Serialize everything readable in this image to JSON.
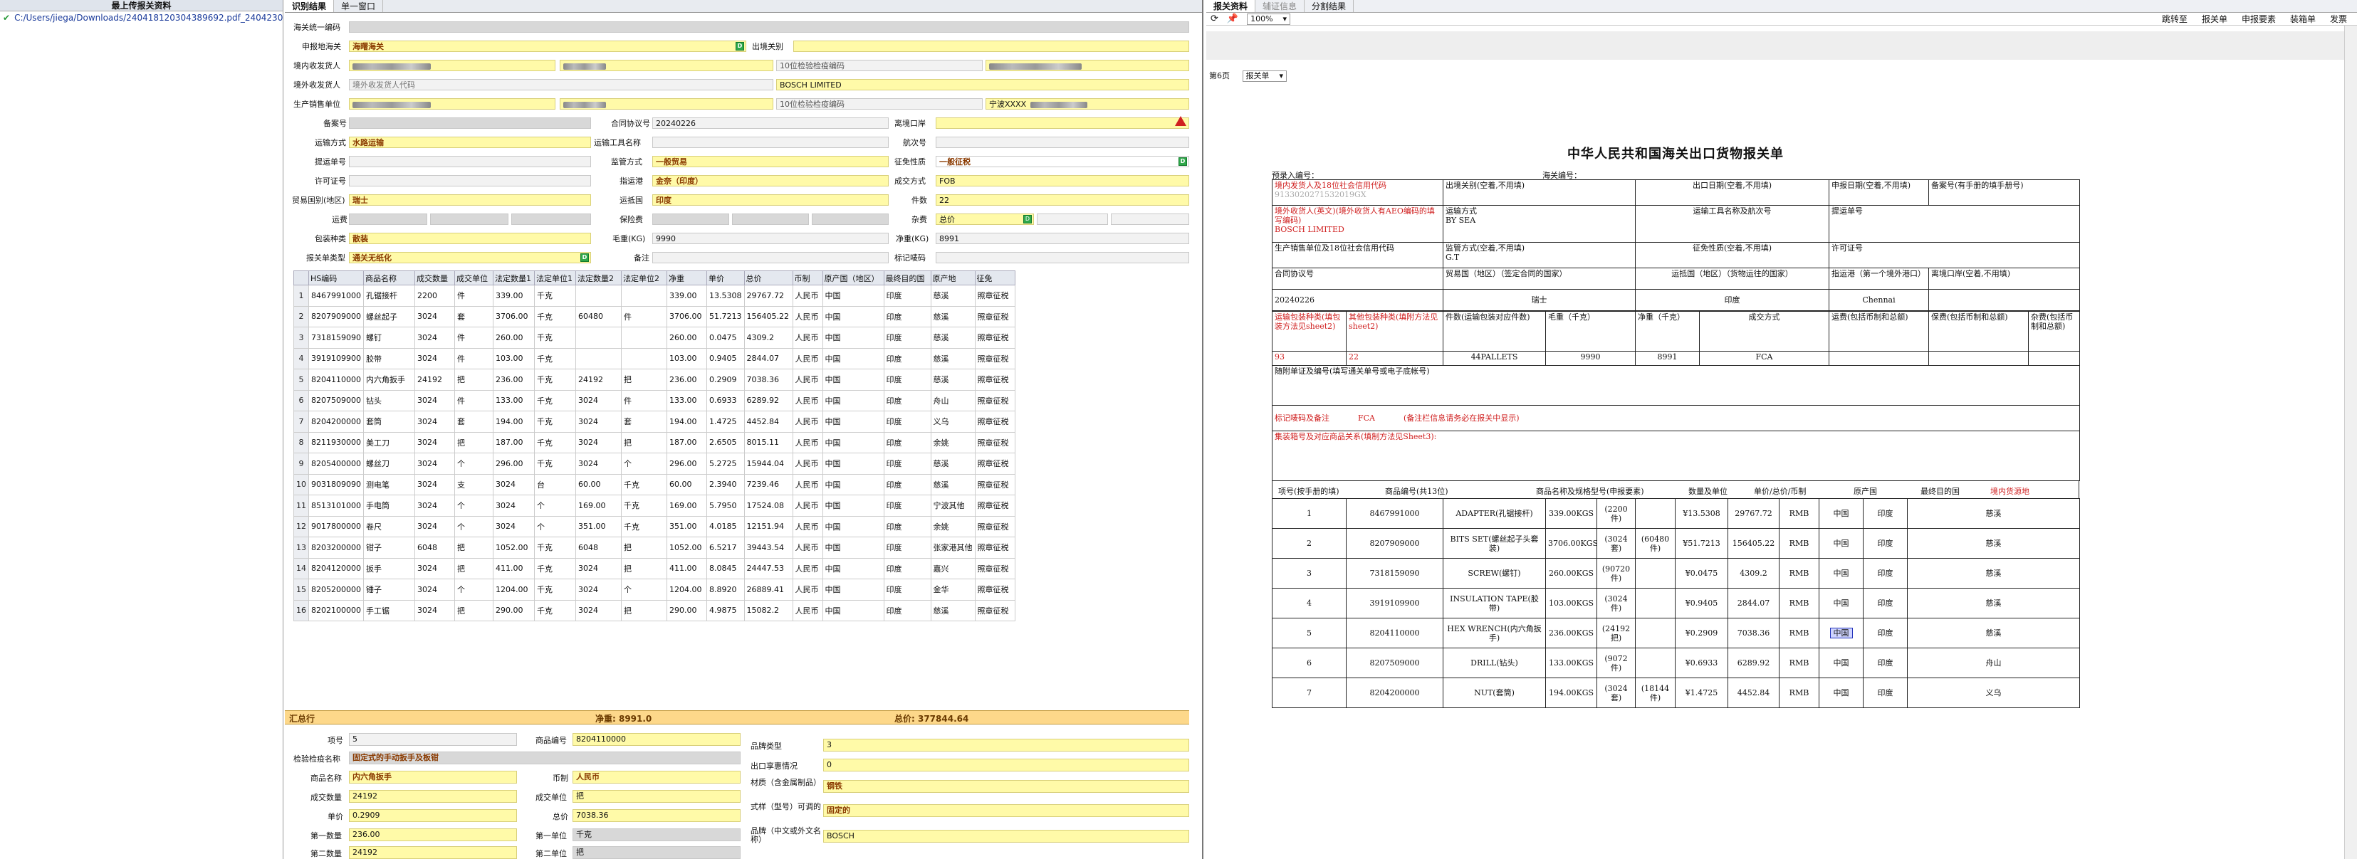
{
  "left_panel": {
    "title": "最上传报关资料",
    "file": "C:/Users/jiega/Downloads/240418120304389692.pdf_240423070"
  },
  "mid_tabs": [
    "识别结果",
    "单一窗口"
  ],
  "form": {
    "pre_entry_no_label": "海关统一编码",
    "declare_customs_label": "申报地海关",
    "declare_customs": "海曙海关",
    "exit_customs_label": "出境关别",
    "domestic_consignor_label": "境内收发货人",
    "domestic_consignor_code": "9133020271532019GX",
    "domestic_consignor_2": "3302...",
    "inspect_code_label": "10位检验检疫编码",
    "overseas_consignee_label": "境外收发货人",
    "overseas_consignee_ph": "境外收发货人代码",
    "overseas_consignee": "BOSCH LIMITED",
    "overseas_inspect_label": "10位检验检疫编码",
    "producer_label": "生产销售单位",
    "producer_company": "宁波XXXX",
    "record_no_label": "备案号",
    "contract_no_label": "合同协议号",
    "contract_no": "20240226",
    "entry_port_label": "离境口岸",
    "transport_label": "运输方式",
    "transport": "水路运输",
    "vehicle_label": "运输工具名称",
    "voyage_label": "航次号",
    "bill_label": "提运单号",
    "supervision_label": "监管方式",
    "supervision": "一般贸易",
    "levy_label": "征免性质",
    "levy": "一般征税",
    "license_label": "许可证号",
    "dest_port_label": "指运港",
    "dest_port": "金奈（印度）",
    "deal_mode_label": "成交方式",
    "deal_mode": "FOB",
    "trade_country_label": "贸易国别(地区)",
    "trade_country": "瑞士",
    "arrive_country_label": "运抵国",
    "arrive_country": "印度",
    "pieces_label": "件数",
    "pieces": "22",
    "freight_label": "运费",
    "insurance_label": "保险费",
    "misc_label": "杂费",
    "misc_type": "总价",
    "package_label": "包装种类",
    "package": "散装",
    "gross_label": "毛重(KG)",
    "gross": "9990",
    "net_label": "净重(KG)",
    "net": "8991",
    "relation_label": "报关单类型",
    "relation": "通关无纸化",
    "remark_label": "备注",
    "mark_label": "标记唛码"
  },
  "goods_table": {
    "headers": [
      "",
      "HS编码",
      "商品名称",
      "成交数量",
      "成交单位",
      "法定数量1",
      "法定单位1",
      "法定数量2",
      "法定单位2",
      "净重",
      "单价",
      "总价",
      "币制",
      "原产国（地区）",
      "最终目的国",
      "原产地",
      "征免"
    ],
    "rows": [
      [
        "1",
        "8467991000",
        "孔锯接杆",
        "2200",
        "件",
        "339.00",
        "千克",
        "",
        "",
        "339.00",
        "13.5308",
        "29767.72",
        "人民币",
        "中国",
        "印度",
        "慈溪",
        "照章征税"
      ],
      [
        "2",
        "8207909000",
        "螺丝起子",
        "3024",
        "套",
        "3706.00",
        "千克",
        "60480",
        "件",
        "3706.00",
        "51.7213",
        "156405.22",
        "人民币",
        "中国",
        "印度",
        "慈溪",
        "照章征税"
      ],
      [
        "3",
        "7318159090",
        "螺钉",
        "3024",
        "件",
        "260.00",
        "千克",
        "",
        "",
        "260.00",
        "0.0475",
        "4309.2",
        "人民币",
        "中国",
        "印度",
        "慈溪",
        "照章征税"
      ],
      [
        "4",
        "3919109900",
        "胶带",
        "3024",
        "件",
        "103.00",
        "千克",
        "",
        "",
        "103.00",
        "0.9405",
        "2844.07",
        "人民币",
        "中国",
        "印度",
        "慈溪",
        "照章征税"
      ],
      [
        "5",
        "8204110000",
        "内六角扳手",
        "24192",
        "把",
        "236.00",
        "千克",
        "24192",
        "把",
        "236.00",
        "0.2909",
        "7038.36",
        "人民币",
        "中国",
        "印度",
        "慈溪",
        "照章征税"
      ],
      [
        "6",
        "8207509000",
        "钻头",
        "3024",
        "件",
        "133.00",
        "千克",
        "3024",
        "件",
        "133.00",
        "0.6933",
        "6289.92",
        "人民币",
        "中国",
        "印度",
        "舟山",
        "照章征税"
      ],
      [
        "7",
        "8204200000",
        "套筒",
        "3024",
        "套",
        "194.00",
        "千克",
        "3024",
        "套",
        "194.00",
        "1.4725",
        "4452.84",
        "人民币",
        "中国",
        "印度",
        "义乌",
        "照章征税"
      ],
      [
        "8",
        "8211930000",
        "美工刀",
        "3024",
        "把",
        "187.00",
        "千克",
        "3024",
        "把",
        "187.00",
        "2.6505",
        "8015.11",
        "人民币",
        "中国",
        "印度",
        "余姚",
        "照章征税"
      ],
      [
        "9",
        "8205400000",
        "螺丝刀",
        "3024",
        "个",
        "296.00",
        "千克",
        "3024",
        "个",
        "296.00",
        "5.2725",
        "15944.04",
        "人民币",
        "中国",
        "印度",
        "慈溪",
        "照章征税"
      ],
      [
        "10",
        "9031809090",
        "测电笔",
        "3024",
        "支",
        "3024",
        "台",
        "60.00",
        "千克",
        "60.00",
        "2.3940",
        "7239.46",
        "人民币",
        "中国",
        "印度",
        "慈溪",
        "照章征税"
      ],
      [
        "11",
        "8513101000",
        "手电筒",
        "3024",
        "个",
        "3024",
        "个",
        "169.00",
        "千克",
        "169.00",
        "5.7950",
        "17524.08",
        "人民币",
        "中国",
        "印度",
        "宁波其他",
        "照章征税"
      ],
      [
        "12",
        "9017800000",
        "卷尺",
        "3024",
        "个",
        "3024",
        "个",
        "351.00",
        "千克",
        "351.00",
        "4.0185",
        "12151.94",
        "人民币",
        "中国",
        "印度",
        "余姚",
        "照章征税"
      ],
      [
        "13",
        "8203200000",
        "钳子",
        "6048",
        "把",
        "1052.00",
        "千克",
        "6048",
        "把",
        "1052.00",
        "6.5217",
        "39443.54",
        "人民币",
        "中国",
        "印度",
        "张家港其他",
        "照章征税"
      ],
      [
        "14",
        "8204120000",
        "扳手",
        "3024",
        "把",
        "411.00",
        "千克",
        "3024",
        "把",
        "411.00",
        "8.0845",
        "24447.53",
        "人民币",
        "中国",
        "印度",
        "嘉兴",
        "照章征税"
      ],
      [
        "15",
        "8205200000",
        "锤子",
        "3024",
        "个",
        "1204.00",
        "千克",
        "3024",
        "个",
        "1204.00",
        "8.8920",
        "26889.41",
        "人民币",
        "中国",
        "印度",
        "金华",
        "照章征税"
      ],
      [
        "16",
        "8202100000",
        "手工锯",
        "3024",
        "把",
        "290.00",
        "千克",
        "3024",
        "把",
        "290.00",
        "4.9875",
        "15082.2",
        "人民币",
        "中国",
        "印度",
        "慈溪",
        "照章征税"
      ]
    ]
  },
  "totals": {
    "label": "汇总行",
    "net": "净重: 8991.0",
    "total": "总价: 377844.64"
  },
  "detail": {
    "item_no_label": "项号",
    "item_no": "5",
    "code_label": "商品编号",
    "code": "8204110000",
    "inspect_label": "检验检疫名称",
    "spec": "固定式的手动扳手及板钳",
    "name_label": "商品名称",
    "name": "内六角扳手",
    "currency_label": "币制",
    "currency": "人民币",
    "qty_label": "成交数量",
    "qty": "24192",
    "unit_label": "成交单位",
    "unit": "把",
    "price_label": "单价",
    "price": "0.2909",
    "total_label": "总价",
    "total": "7038.36",
    "law_qty1_label": "第一数量",
    "law_qty1": "236.00",
    "law_unit1_label": "第一单位",
    "law_unit1": "千克",
    "law_qty2_label": "第二数量",
    "law_qty2": "24192",
    "law_unit2_label": "第二单位",
    "law_unit2": "把",
    "brand_type_label": "品牌类型",
    "brand_type": "3",
    "export_pref_label": "出口享惠情况",
    "export_pref": "0",
    "material_label": "材质（含金属制品）",
    "material": "钢铁",
    "model_label": "式样（型号）可调的",
    "model": "固定的",
    "brand_label": "品牌（中文或外文名称）",
    "brand": "BOSCH"
  },
  "right": {
    "tabs": [
      "报关资料",
      "辅证信息",
      "分割结果"
    ],
    "zoom": "100%",
    "buttons": [
      "跳转至",
      "报关单",
      "申报要素",
      "装箱单",
      "发票"
    ],
    "page_label": "第6页",
    "page_select": "报关单",
    "doc": {
      "title": "中华人民共和国海关出口货物报关单",
      "pre_no": "预录入编号：",
      "customs_no": "海关编号：",
      "r1": [
        "境内发货人及18位社会信用代码",
        "出境关别(空着,不用填)",
        "出口日期(空着,不用填)",
        "申报日期(空着,不用填)",
        "备案号(有手册的填手册号)"
      ],
      "r1_val": "9133020271532019GX",
      "r2": [
        "境外收货人(英文)(境外收货人有AEO编码的填写编码)",
        "运输方式",
        "运输工具名称及航次号",
        "提运单号"
      ],
      "r2_val": "BOSCH LIMITED",
      "r2_transport": "BY SEA",
      "r3": [
        "生产销售单位及18位社会信用代码",
        "监管方式(空着,不用填)",
        "征免性质(空着,不用填)",
        "许可证号"
      ],
      "r3_val": "G.T",
      "r4": [
        "合同协议号",
        "贸易国（地区）（签定合同的国家）",
        "运抵国（地区）（货物运往的国家）",
        "指运港（第一个境外港口）",
        "离境口岸(空着,不用填)"
      ],
      "r4_vals": [
        "20240226",
        "瑞士",
        "印度",
        "Chennai"
      ],
      "r5": [
        "运输包装种类(填包装方法见sheet2)",
        "其他包装种类(填附方法见sheet2)",
        "件数(运输包装对应件数)",
        "毛重（千克）",
        "净重（千克）",
        "成交方式",
        "运费(包括币制和总额)",
        "保费(包括币制和总额)",
        "杂费(包括币制和总额)"
      ],
      "r5_vals": [
        "93",
        "22",
        "44PALLETS",
        "9990",
        "8991",
        "FCA"
      ],
      "r6": "随附单证及编号(填写通关单号或电子底帐号)",
      "r7": "标记唛码及备注",
      "r7_val": "FCA",
      "r7_note": "(备注栏信息请务必在报关中显示)",
      "r8": "集装箱号及对应商品关系(填制方法见Sheet3):",
      "item_headers": [
        "项号(按手册的填)",
        "商品编号(共13位)",
        "商品名称及规格型号(申报要素)",
        "数量及单位",
        "单价/总价/币制",
        "原产国",
        "最终目的国",
        "境内货源地"
      ],
      "items": [
        [
          "1",
          "8467991000",
          "ADAPTER(孔锯接杆)",
          "339.00KGS",
          "(2200件)",
          "",
          "¥13.5308",
          "29767.72",
          "RMB",
          "中国",
          "印度",
          "慈溪"
        ],
        [
          "2",
          "8207909000",
          "BITS SET(螺丝起子头套装)",
          "3706.00KGS",
          "(3024套)",
          "(60480件)",
          "¥51.7213",
          "156405.22",
          "RMB",
          "中国",
          "印度",
          "慈溪"
        ],
        [
          "3",
          "7318159090",
          "SCREW(螺钉)",
          "260.00KGS",
          "(90720件)",
          "",
          "¥0.0475",
          "4309.2",
          "RMB",
          "中国",
          "印度",
          "慈溪"
        ],
        [
          "4",
          "3919109900",
          "INSULATION TAPE(胶带)",
          "103.00KGS",
          "(3024件)",
          "",
          "¥0.9405",
          "2844.07",
          "RMB",
          "中国",
          "印度",
          "慈溪"
        ],
        [
          "5",
          "8204110000",
          "HEX WRENCH(内六角扳手)",
          "236.00KGS",
          "(24192把)",
          "",
          "¥0.2909",
          "7038.36",
          "RMB",
          "中国",
          "印度",
          "慈溪"
        ],
        [
          "6",
          "8207509000",
          "DRILL(钻头)",
          "133.00KGS",
          "(9072件)",
          "",
          "¥0.6933",
          "6289.92",
          "RMB",
          "中国",
          "印度",
          "舟山"
        ],
        [
          "7",
          "8204200000",
          "NUT(套筒)",
          "194.00KGS",
          "(3024套)",
          "(18144件)",
          "¥1.4725",
          "4452.84",
          "RMB",
          "中国",
          "印度",
          "义乌"
        ]
      ]
    }
  }
}
